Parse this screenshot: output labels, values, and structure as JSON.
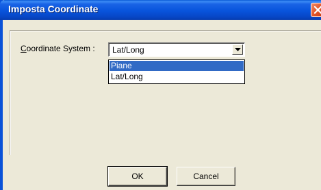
{
  "window": {
    "title": "Imposta Coordinate",
    "close_icon": "close-icon"
  },
  "form": {
    "coordinate_label_accel": "C",
    "coordinate_label_rest": "oordinate System :",
    "selected_value": "Lat/Long",
    "options": [
      "Piane",
      "Lat/Long"
    ],
    "highlighted_option": "Piane"
  },
  "buttons": {
    "ok_label": "OK",
    "cancel_label": "Cancel"
  },
  "colors": {
    "titlebar": "#0854dc",
    "selection": "#316ac5",
    "face": "#ece9d8",
    "close": "#e0562a"
  }
}
